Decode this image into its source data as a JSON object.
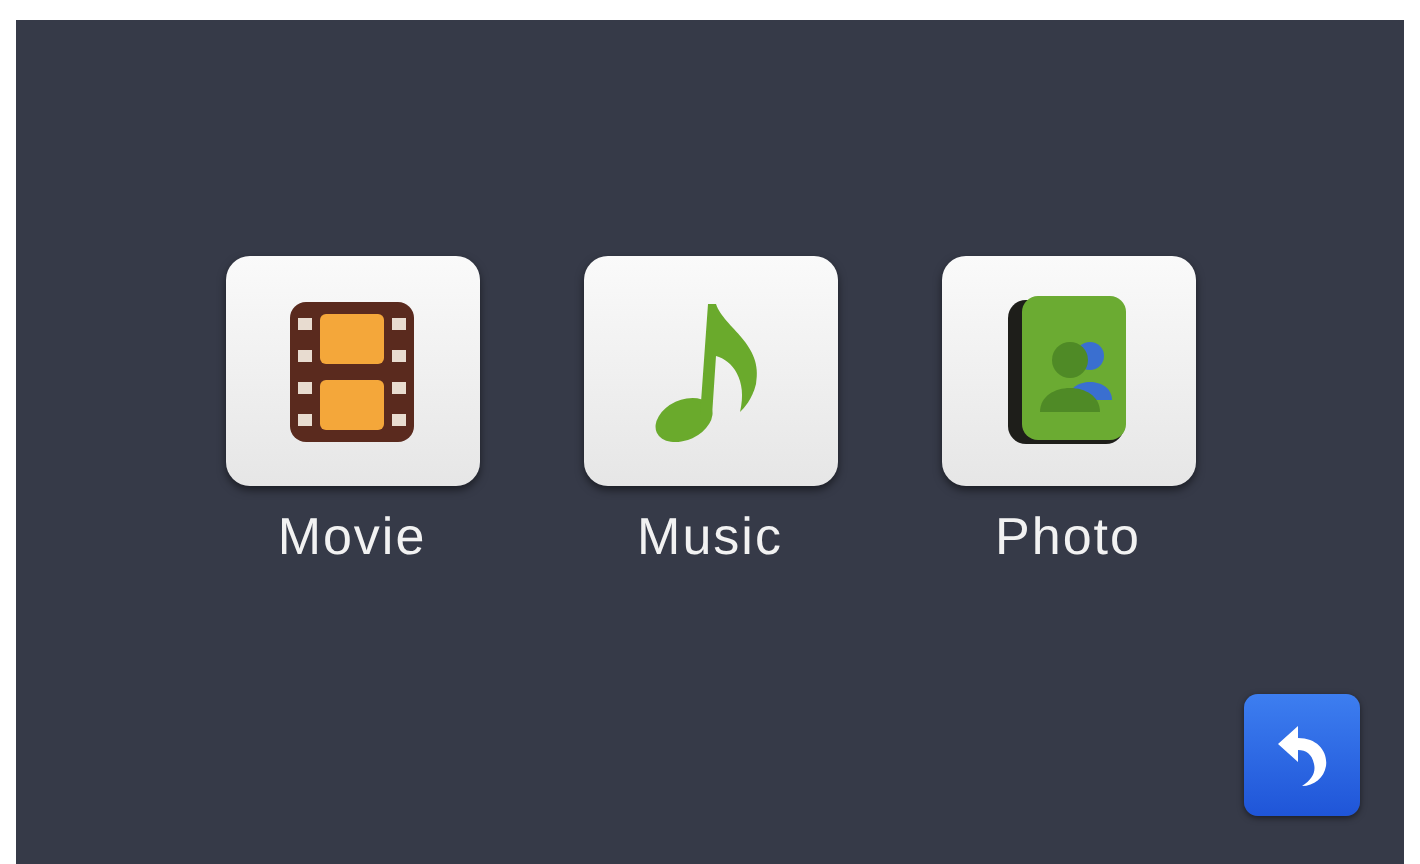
{
  "apps": [
    {
      "kind": "movie",
      "label": "Movie"
    },
    {
      "kind": "music",
      "label": "Music"
    },
    {
      "kind": "photo",
      "label": "Photo"
    }
  ]
}
